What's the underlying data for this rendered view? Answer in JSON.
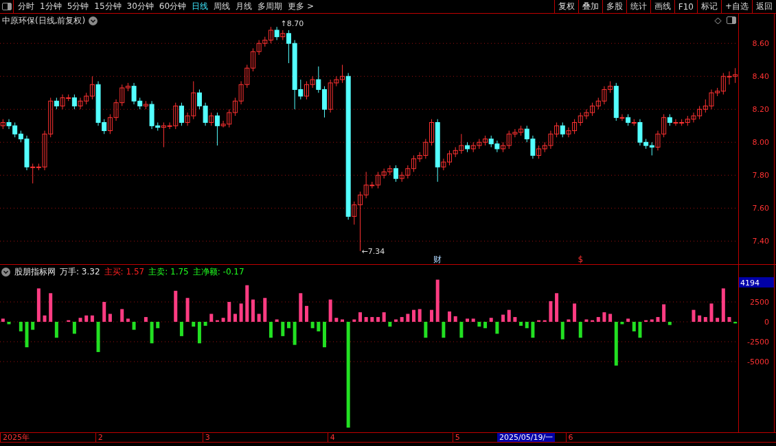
{
  "toolbar": {
    "periods": [
      {
        "label": "分时",
        "selected": false
      },
      {
        "label": "1分钟",
        "selected": false
      },
      {
        "label": "5分钟",
        "selected": false
      },
      {
        "label": "15分钟",
        "selected": false
      },
      {
        "label": "30分钟",
        "selected": false
      },
      {
        "label": "60分钟",
        "selected": false
      },
      {
        "label": "日线",
        "selected": true
      },
      {
        "label": "周线",
        "selected": false
      },
      {
        "label": "月线",
        "selected": false
      },
      {
        "label": "多周期",
        "selected": false
      },
      {
        "label": "更多 >",
        "selected": false
      }
    ],
    "actions": [
      "复权",
      "叠加",
      "多股",
      "统计",
      "画线",
      "F10",
      "标记",
      "+自选",
      "返回"
    ]
  },
  "price_chart": {
    "title": "中原环保(日线,前复权)",
    "high_label": "↑8.70",
    "low_label": "←7.34",
    "event_markers": [
      "财",
      "$"
    ],
    "chart_data": {
      "type": "candlestick",
      "grid": true,
      "ylim": [
        7.26,
        8.78
      ],
      "yticks": [
        {
          "value": 8.6,
          "label": "8.60"
        },
        {
          "value": 8.4,
          "label": "8.40"
        },
        {
          "value": 8.2,
          "label": "8.20"
        },
        {
          "value": 8.0,
          "label": "8.00"
        },
        {
          "value": 7.8,
          "label": "7.80"
        },
        {
          "value": 7.6,
          "label": "7.60"
        },
        {
          "value": 7.4,
          "label": "7.40"
        }
      ],
      "ohlc": [
        [
          8.1,
          8.14,
          8.08,
          8.12
        ],
        [
          8.12,
          8.14,
          8.08,
          8.1
        ],
        [
          8.1,
          8.12,
          8.03,
          8.05
        ],
        [
          8.05,
          8.07,
          8.0,
          8.02
        ],
        [
          8.02,
          8.04,
          7.83,
          7.85
        ],
        [
          7.85,
          7.87,
          7.75,
          7.85
        ],
        [
          7.85,
          7.87,
          7.83,
          7.85
        ],
        [
          7.85,
          8.07,
          7.83,
          8.05
        ],
        [
          8.05,
          8.27,
          8.03,
          8.25
        ],
        [
          8.25,
          8.27,
          8.2,
          8.22
        ],
        [
          8.22,
          8.29,
          8.2,
          8.27
        ],
        [
          8.27,
          8.29,
          8.25,
          8.27
        ],
        [
          8.27,
          8.29,
          8.2,
          8.22
        ],
        [
          8.22,
          8.27,
          8.2,
          8.25
        ],
        [
          8.25,
          8.3,
          8.23,
          8.28
        ],
        [
          8.28,
          8.4,
          8.26,
          8.35
        ],
        [
          8.35,
          8.37,
          8.1,
          8.12
        ],
        [
          8.12,
          8.14,
          8.05,
          8.07
        ],
        [
          8.07,
          8.17,
          8.05,
          8.15
        ],
        [
          8.15,
          8.26,
          8.13,
          8.24
        ],
        [
          8.24,
          8.35,
          8.22,
          8.33
        ],
        [
          8.33,
          8.36,
          8.31,
          8.34
        ],
        [
          8.34,
          8.36,
          8.23,
          8.25
        ],
        [
          8.25,
          8.27,
          8.2,
          8.22
        ],
        [
          8.22,
          8.25,
          8.2,
          8.23
        ],
        [
          8.23,
          8.25,
          8.08,
          8.1
        ],
        [
          8.1,
          8.12,
          8.07,
          8.09
        ],
        [
          8.09,
          8.12,
          7.97,
          8.1
        ],
        [
          8.1,
          8.12,
          8.08,
          8.1
        ],
        [
          8.1,
          8.24,
          8.08,
          8.22
        ],
        [
          8.22,
          8.24,
          8.1,
          8.12
        ],
        [
          8.12,
          8.18,
          8.1,
          8.16
        ],
        [
          8.16,
          8.37,
          8.14,
          8.3
        ],
        [
          8.3,
          8.32,
          8.2,
          8.22
        ],
        [
          8.22,
          8.24,
          8.1,
          8.12
        ],
        [
          8.12,
          8.18,
          8.1,
          8.16
        ],
        [
          8.16,
          8.18,
          7.98,
          8.1
        ],
        [
          8.1,
          8.13,
          8.09,
          8.11
        ],
        [
          8.11,
          8.2,
          8.09,
          8.18
        ],
        [
          8.18,
          8.27,
          8.16,
          8.25
        ],
        [
          8.25,
          8.37,
          8.23,
          8.35
        ],
        [
          8.35,
          8.47,
          8.33,
          8.45
        ],
        [
          8.45,
          8.57,
          8.43,
          8.55
        ],
        [
          8.55,
          8.62,
          8.53,
          8.6
        ],
        [
          8.6,
          8.64,
          8.58,
          8.62
        ],
        [
          8.62,
          8.7,
          8.6,
          8.68
        ],
        [
          8.68,
          8.7,
          8.62,
          8.64
        ],
        [
          8.64,
          8.68,
          8.62,
          8.66
        ],
        [
          8.66,
          8.68,
          8.48,
          8.6
        ],
        [
          8.6,
          8.62,
          8.2,
          8.32
        ],
        [
          8.32,
          8.38,
          8.26,
          8.28
        ],
        [
          8.28,
          8.37,
          8.26,
          8.35
        ],
        [
          8.35,
          8.4,
          8.33,
          8.38
        ],
        [
          8.38,
          8.46,
          8.3,
          8.32
        ],
        [
          8.32,
          8.34,
          8.15,
          8.2
        ],
        [
          8.2,
          8.38,
          8.18,
          8.36
        ],
        [
          8.36,
          8.4,
          8.34,
          8.38
        ],
        [
          8.38,
          8.47,
          8.36,
          8.4
        ],
        [
          8.4,
          8.42,
          7.53,
          7.55
        ],
        [
          7.55,
          7.64,
          7.5,
          7.62
        ],
        [
          7.62,
          7.7,
          7.34,
          7.68
        ],
        [
          7.68,
          7.82,
          7.66,
          7.74
        ],
        [
          7.74,
          7.76,
          7.72,
          7.74
        ],
        [
          7.74,
          7.82,
          7.72,
          7.8
        ],
        [
          7.8,
          7.84,
          7.78,
          7.82
        ],
        [
          7.82,
          7.86,
          7.8,
          7.84
        ],
        [
          7.84,
          7.86,
          7.76,
          7.78
        ],
        [
          7.78,
          7.82,
          7.76,
          7.8
        ],
        [
          7.8,
          7.86,
          7.78,
          7.84
        ],
        [
          7.84,
          7.92,
          7.82,
          7.9
        ],
        [
          7.9,
          7.94,
          7.88,
          7.92
        ],
        [
          7.92,
          8.02,
          7.9,
          8.0
        ],
        [
          8.0,
          8.14,
          7.98,
          8.12
        ],
        [
          8.12,
          8.14,
          7.76,
          7.85
        ],
        [
          7.85,
          7.9,
          7.83,
          7.88
        ],
        [
          7.88,
          7.95,
          7.86,
          7.93
        ],
        [
          7.93,
          7.97,
          7.91,
          7.95
        ],
        [
          7.95,
          8.05,
          7.93,
          7.98
        ],
        [
          7.98,
          8.0,
          7.94,
          7.96
        ],
        [
          7.96,
          8.0,
          7.94,
          7.98
        ],
        [
          7.98,
          8.02,
          7.96,
          8.0
        ],
        [
          8.0,
          8.04,
          7.98,
          8.02
        ],
        [
          8.02,
          8.04,
          7.97,
          7.99
        ],
        [
          7.99,
          8.01,
          7.94,
          7.96
        ],
        [
          7.96,
          8.0,
          7.94,
          7.98
        ],
        [
          7.98,
          8.07,
          7.96,
          8.05
        ],
        [
          8.05,
          8.08,
          8.03,
          8.06
        ],
        [
          8.06,
          8.1,
          8.04,
          8.08
        ],
        [
          8.08,
          8.1,
          8.0,
          8.02
        ],
        [
          8.02,
          8.04,
          7.9,
          7.92
        ],
        [
          7.92,
          7.98,
          7.9,
          7.96
        ],
        [
          7.96,
          8.0,
          7.94,
          7.98
        ],
        [
          7.98,
          8.07,
          7.96,
          8.05
        ],
        [
          8.05,
          8.12,
          8.03,
          8.1
        ],
        [
          8.1,
          8.12,
          8.03,
          8.05
        ],
        [
          8.05,
          8.09,
          8.03,
          8.07
        ],
        [
          8.07,
          8.14,
          8.05,
          8.12
        ],
        [
          8.12,
          8.18,
          8.1,
          8.16
        ],
        [
          8.16,
          8.2,
          8.14,
          8.18
        ],
        [
          8.18,
          8.24,
          8.16,
          8.22
        ],
        [
          8.22,
          8.27,
          8.2,
          8.25
        ],
        [
          8.25,
          8.34,
          8.23,
          8.32
        ],
        [
          8.32,
          8.37,
          8.3,
          8.34
        ],
        [
          8.34,
          8.36,
          8.13,
          8.15
        ],
        [
          8.15,
          8.17,
          8.13,
          8.15
        ],
        [
          8.15,
          8.17,
          8.1,
          8.12
        ],
        [
          8.12,
          8.14,
          8.1,
          8.12
        ],
        [
          8.12,
          8.14,
          7.98,
          8.0
        ],
        [
          8.0,
          8.02,
          7.96,
          7.98
        ],
        [
          7.98,
          8.0,
          7.92,
          7.97
        ],
        [
          7.97,
          8.07,
          7.95,
          8.05
        ],
        [
          8.05,
          8.17,
          8.03,
          8.15
        ],
        [
          8.15,
          8.17,
          8.1,
          8.12
        ],
        [
          8.12,
          8.14,
          8.1,
          8.12
        ],
        [
          8.12,
          8.14,
          8.1,
          8.12
        ],
        [
          8.12,
          8.16,
          8.1,
          8.14
        ],
        [
          8.14,
          8.18,
          8.12,
          8.16
        ],
        [
          8.16,
          8.22,
          8.14,
          8.2
        ],
        [
          8.2,
          8.26,
          8.18,
          8.22
        ],
        [
          8.22,
          8.32,
          8.2,
          8.3
        ],
        [
          8.3,
          8.33,
          8.28,
          8.31
        ],
        [
          8.31,
          8.42,
          8.29,
          8.4
        ],
        [
          8.4,
          8.43,
          8.35,
          8.4
        ],
        [
          8.4,
          8.45,
          8.36,
          8.41
        ]
      ]
    }
  },
  "indicator": {
    "name": "股朋指标网",
    "readings": [
      {
        "label": "万手: 3.32",
        "color": "#e6e6e6"
      },
      {
        "label": "主买: 1.57",
        "color": "#ff2020"
      },
      {
        "label": "主卖: 1.75",
        "color": "#20ff20"
      },
      {
        "label": "主净额: -0.17",
        "color": "#20ff20"
      }
    ],
    "axis_highlight": "4194",
    "chart_data": {
      "type": "bar",
      "grid": true,
      "stacked": true,
      "ylim": [
        -13970,
        7160
      ],
      "yticks": [
        2500,
        0,
        -2500,
        -5000
      ],
      "series": [
        {
          "color": "#ff3c82",
          "values": [
            400,
            null,
            null,
            null,
            null,
            null,
            4200,
            800,
            3600,
            null,
            null,
            200,
            null,
            500,
            800,
            800,
            null,
            2500,
            1000,
            null,
            1600,
            400,
            null,
            null,
            600,
            null,
            null,
            null,
            null,
            3900,
            null,
            3000,
            null,
            null,
            null,
            1000,
            200,
            500,
            2500,
            1000,
            2300,
            4600,
            2800,
            1000,
            3000,
            null,
            300,
            null,
            null,
            null,
            3600,
            2000,
            null,
            null,
            null,
            2800,
            500,
            300,
            null,
            300,
            1200,
            600,
            600,
            600,
            1200,
            null,
            300,
            600,
            1000,
            1500,
            1600,
            null,
            1500,
            5300,
            null,
            1300,
            700,
            null,
            400,
            400,
            null,
            null,
            500,
            null,
            900,
            1500,
            600,
            null,
            null,
            null,
            200,
            200,
            2600,
            3600,
            null,
            300,
            2300,
            null,
            300,
            200,
            600,
            1200,
            1000,
            null,
            null,
            400,
            null,
            null,
            200,
            300,
            600,
            2200,
            null,
            null,
            null,
            null,
            1500,
            800,
            600,
            2300,
            500,
            4200,
            600,
            null
          ]
        },
        {
          "color": "#22e022",
          "values": [
            null,
            -300,
            null,
            -1200,
            -3200,
            -1000,
            null,
            null,
            null,
            -2000,
            null,
            null,
            -1500,
            null,
            null,
            null,
            -3800,
            null,
            null,
            null,
            null,
            null,
            -1000,
            null,
            null,
            -2700,
            -800,
            null,
            null,
            null,
            -1800,
            null,
            -600,
            -2700,
            -500,
            null,
            null,
            null,
            null,
            null,
            null,
            null,
            null,
            null,
            null,
            -2000,
            null,
            -1800,
            -800,
            -2900,
            null,
            null,
            -800,
            -1200,
            -3200,
            null,
            null,
            null,
            -13300,
            null,
            null,
            null,
            null,
            null,
            null,
            -600,
            null,
            null,
            null,
            null,
            null,
            -2000,
            null,
            null,
            -2000,
            null,
            null,
            -2000,
            null,
            null,
            -600,
            -800,
            null,
            -1500,
            null,
            null,
            null,
            -500,
            -800,
            -2000,
            null,
            null,
            null,
            null,
            -2200,
            null,
            null,
            -2000,
            null,
            null,
            null,
            null,
            null,
            -5500,
            -300,
            null,
            -1200,
            -2000,
            null,
            null,
            null,
            null,
            -400,
            null,
            null,
            null,
            null,
            null,
            null,
            null,
            null,
            null,
            null,
            -200
          ]
        }
      ]
    }
  },
  "date_axis": [
    "2025年",
    "2",
    "3",
    "4",
    "5",
    "6"
  ],
  "cursor_date": "2025/05/19/一"
}
